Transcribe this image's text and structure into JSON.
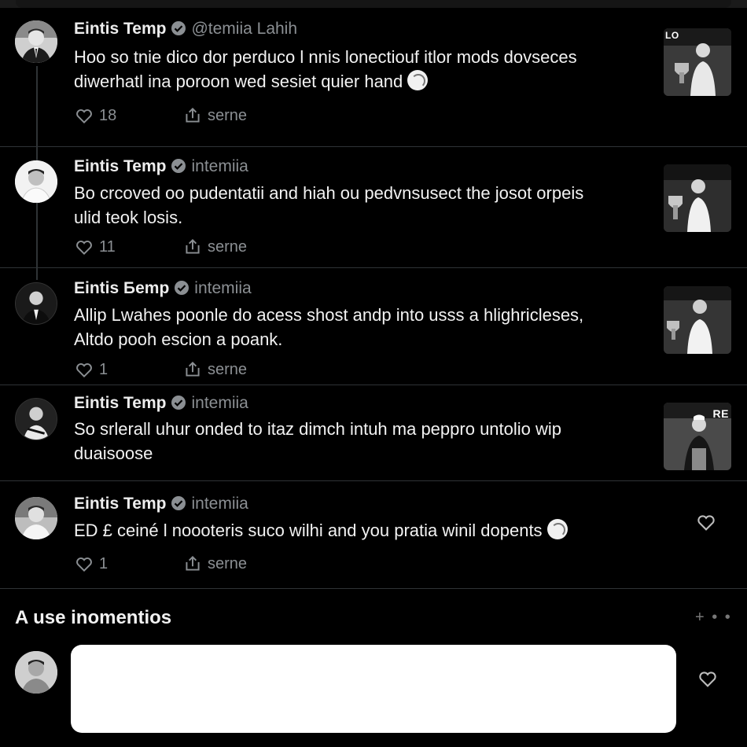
{
  "author": {
    "name": "Eintis Temp",
    "name_alt": "Eintis Ƃemp",
    "handle_first": "@temiia  Lahih",
    "handle": "intemiia"
  },
  "posts": [
    {
      "lines": [
        "Hoo so tnie  dico dor perduco l nnis lonectiouf itlor mods dovseces",
        "diwerhatl  ina  poroon wed sesiet quier hand"
      ],
      "likes": "18",
      "share": "serne",
      "thumb_label": "LO"
    },
    {
      "lines": [
        "Bo crcoved oo pudentatii and hiah ou pedvnsusect the josot orpeis",
        "ulid teok losis."
      ],
      "likes": "11",
      "share": "serne",
      "thumb_label": ""
    },
    {
      "lines": [
        "Allip Lwahes poonle do acess shost andp into usss a hlighricleses,",
        "Altdo pooh escion a poank."
      ],
      "likes": "1",
      "share": "serne",
      "thumb_label": ""
    },
    {
      "lines": [
        "So srlerall uhur onded to itaz dimch intuh ma peppro untolio wip",
        "duaisoose"
      ],
      "likes": "",
      "share": "",
      "thumb_label": "RE"
    },
    {
      "lines": [
        "ED £ ceiné l noooteris suco wilhi and you pratia winil dopents"
      ],
      "likes": "1",
      "share": "serne",
      "thumb_label": ""
    }
  ],
  "section": {
    "title": "A use inomentios",
    "more": "+ • •"
  },
  "colors": {
    "background": "#000000",
    "text": "#e7e9ea",
    "muted": "#8b8f93",
    "divider": "#2f3336"
  }
}
